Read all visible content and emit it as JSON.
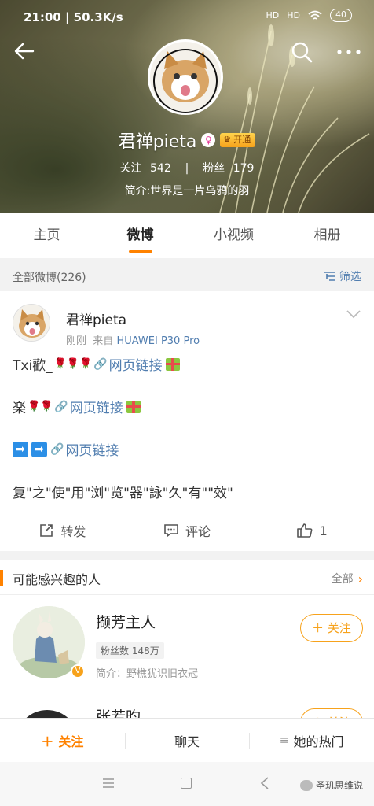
{
  "status_bar": {
    "time_speed": "21:00 | 50.3K/s",
    "battery": "40",
    "signal1": "HD",
    "signal2": "HD"
  },
  "profile": {
    "name": "君禅pieta",
    "vip_label": "开通",
    "following_label": "关注",
    "following_count": "542",
    "fans_label": "粉丝",
    "fans_count": "179",
    "bio": "简介:世界是一片乌鸦的羽"
  },
  "tabs": [
    {
      "label": "主页"
    },
    {
      "label": "微博"
    },
    {
      "label": "小视频"
    },
    {
      "label": "相册"
    }
  ],
  "filter": {
    "label": "全部微博(226)",
    "button": "筛选"
  },
  "post": {
    "author": "君禅pieta",
    "time": "刚刚",
    "source_prefix": "来自",
    "source": "HUAWEI P30 Pro",
    "line1_prefix": "Txi歡_",
    "line2_prefix": "楽",
    "link_text": "网页链接",
    "line4": "复\"之\"使\"用\"浏\"览\"器\"詠\"久\"有\"\"效\"",
    "repost": "转发",
    "comment": "评论",
    "like_count": "1"
  },
  "recommend": {
    "title": "可能感兴趣的人",
    "all": "全部",
    "person1": {
      "name": "撷芳主人",
      "fans": "粉丝数 148万",
      "desc": "简介：野樵犹识旧衣冠",
      "follow": "关注"
    },
    "person2": {
      "name": "张若昀",
      "follow": "关注"
    }
  },
  "bottom_bar": {
    "follow": "关注",
    "chat": "聊天",
    "hot": "她的热门"
  },
  "watermark": "圣玑思维说",
  "colors": {
    "accent": "#ff8200",
    "link": "#507daf",
    "follow_border": "#f7a21b"
  }
}
